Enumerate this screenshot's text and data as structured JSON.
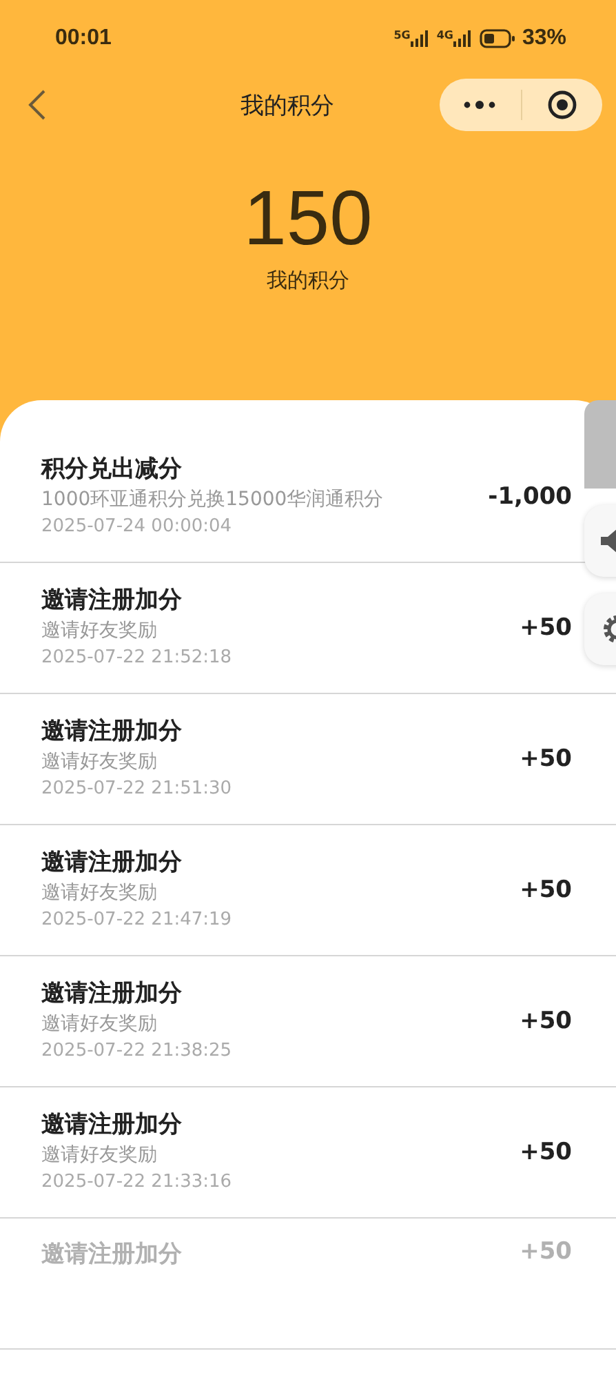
{
  "status_bar": {
    "time": "00:01",
    "network_1": "5G",
    "network_2": "4G",
    "battery": "33%"
  },
  "nav": {
    "title": "我的积分"
  },
  "points": {
    "value": "150",
    "label": "我的积分"
  },
  "records": [
    {
      "title": "积分兑出减分",
      "description": "1000环亚通积分兑换15000华润通积分",
      "time": "2025-07-24 00:00:04",
      "amount": "-1,000"
    },
    {
      "title": "邀请注册加分",
      "description": "邀请好友奖励",
      "time": "2025-07-22 21:52:18",
      "amount": "+50"
    },
    {
      "title": "邀请注册加分",
      "description": "邀请好友奖励",
      "time": "2025-07-22 21:51:30",
      "amount": "+50"
    },
    {
      "title": "邀请注册加分",
      "description": "邀请好友奖励",
      "time": "2025-07-22 21:47:19",
      "amount": "+50"
    },
    {
      "title": "邀请注册加分",
      "description": "邀请好友奖励",
      "time": "2025-07-22 21:38:25",
      "amount": "+50"
    },
    {
      "title": "邀请注册加分",
      "description": "邀请好友奖励",
      "time": "2025-07-22 21:33:16",
      "amount": "+50"
    },
    {
      "title": "邀请注册加分",
      "amount": "+50"
    }
  ]
}
